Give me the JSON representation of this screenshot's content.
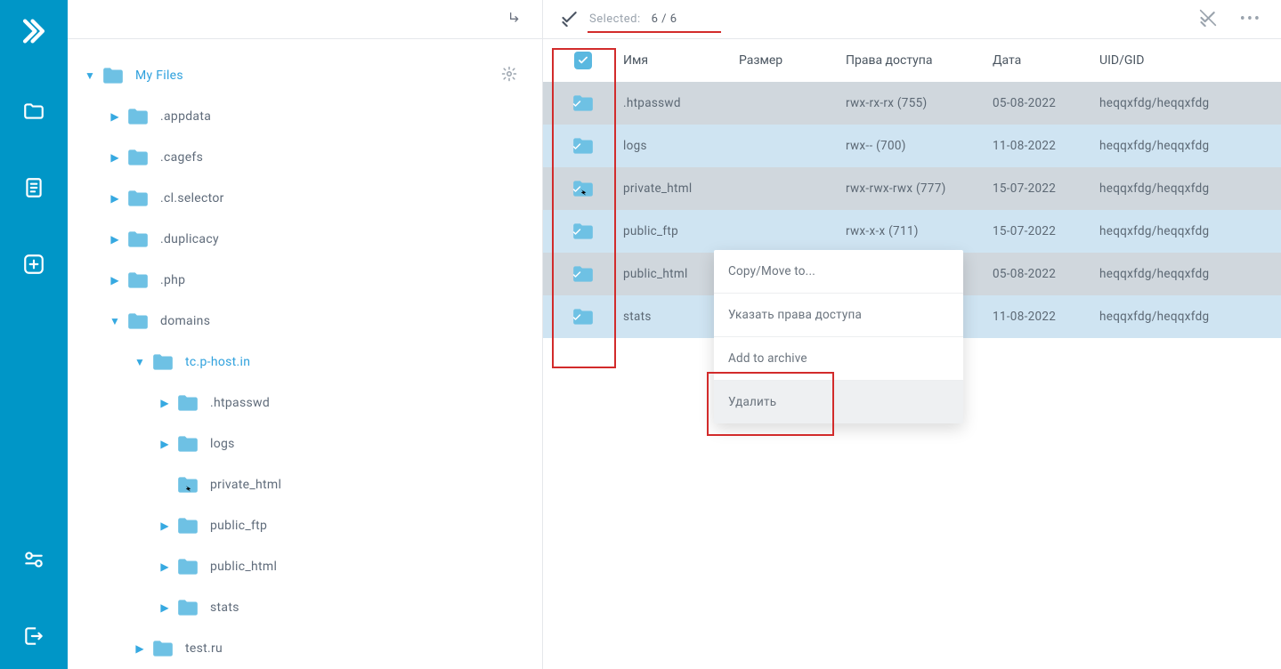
{
  "leftbar": {
    "items": [
      "logo",
      "files",
      "doc",
      "add",
      "settings",
      "logout"
    ]
  },
  "tree": {
    "root": {
      "label": "My Files"
    },
    "items": [
      {
        "label": ".appdata",
        "depth": 1,
        "caret": "right"
      },
      {
        "label": ".cagefs",
        "depth": 1,
        "caret": "right"
      },
      {
        "label": ".cl.selector",
        "depth": 1,
        "caret": "right"
      },
      {
        "label": ".duplicacy",
        "depth": 1,
        "caret": "right"
      },
      {
        "label": ".php",
        "depth": 1,
        "caret": "right"
      },
      {
        "label": "domains",
        "depth": 1,
        "caret": "down"
      },
      {
        "label": "tc.p-host.in",
        "depth": 2,
        "caret": "down",
        "active": true
      },
      {
        "label": ".htpasswd",
        "depth": 3,
        "caret": "right"
      },
      {
        "label": "logs",
        "depth": 3,
        "caret": "right"
      },
      {
        "label": "private_html",
        "depth": 3,
        "caret": "none",
        "link": true
      },
      {
        "label": "public_ftp",
        "depth": 3,
        "caret": "right"
      },
      {
        "label": "public_html",
        "depth": 3,
        "caret": "right"
      },
      {
        "label": "stats",
        "depth": 3,
        "caret": "right"
      },
      {
        "label": "test.ru",
        "depth": 2,
        "caret": "right"
      }
    ]
  },
  "topbar": {
    "selected_label": "Selected:",
    "selected_count": "6 / 6"
  },
  "table": {
    "headers": {
      "name": "Имя",
      "size": "Размер",
      "perm": "Права доступа",
      "date": "Дата",
      "uid": "UID/GID"
    },
    "rows": [
      {
        "name": ".htpasswd",
        "size": "",
        "perm": "rwx-rx-rx (755)",
        "date": "05-08-2022",
        "uid": "heqqxfdg/heqqxfdg",
        "link": false
      },
      {
        "name": "logs",
        "size": "",
        "perm": "rwx-- (700)",
        "date": "11-08-2022",
        "uid": "heqqxfdg/heqqxfdg",
        "link": false
      },
      {
        "name": "private_html",
        "size": "",
        "perm": "rwx-rwx-rwx (777)",
        "date": "15-07-2022",
        "uid": "heqqxfdg/heqqxfdg",
        "link": true
      },
      {
        "name": "public_ftp",
        "size": "",
        "perm": "rwx-x-x (711)",
        "date": "15-07-2022",
        "uid": "heqqxfdg/heqqxfdg",
        "link": false
      },
      {
        "name": "public_html",
        "size": "",
        "perm": "",
        "date": "05-08-2022",
        "uid": "heqqxfdg/heqqxfdg",
        "link": false
      },
      {
        "name": "stats",
        "size": "",
        "perm": "",
        "date": "11-08-2022",
        "uid": "heqqxfdg/heqqxfdg",
        "link": false
      }
    ]
  },
  "context_menu": {
    "items": [
      {
        "label": "Copy/Move to...",
        "highlighted": false
      },
      {
        "label": "Указать права доступа",
        "highlighted": false
      },
      {
        "label": "Add to archive",
        "highlighted": false
      },
      {
        "label": "Удалить",
        "highlighted": true
      }
    ]
  },
  "annotations": {
    "top_redline": true,
    "check_redbox": true,
    "delete_redbox": true
  }
}
